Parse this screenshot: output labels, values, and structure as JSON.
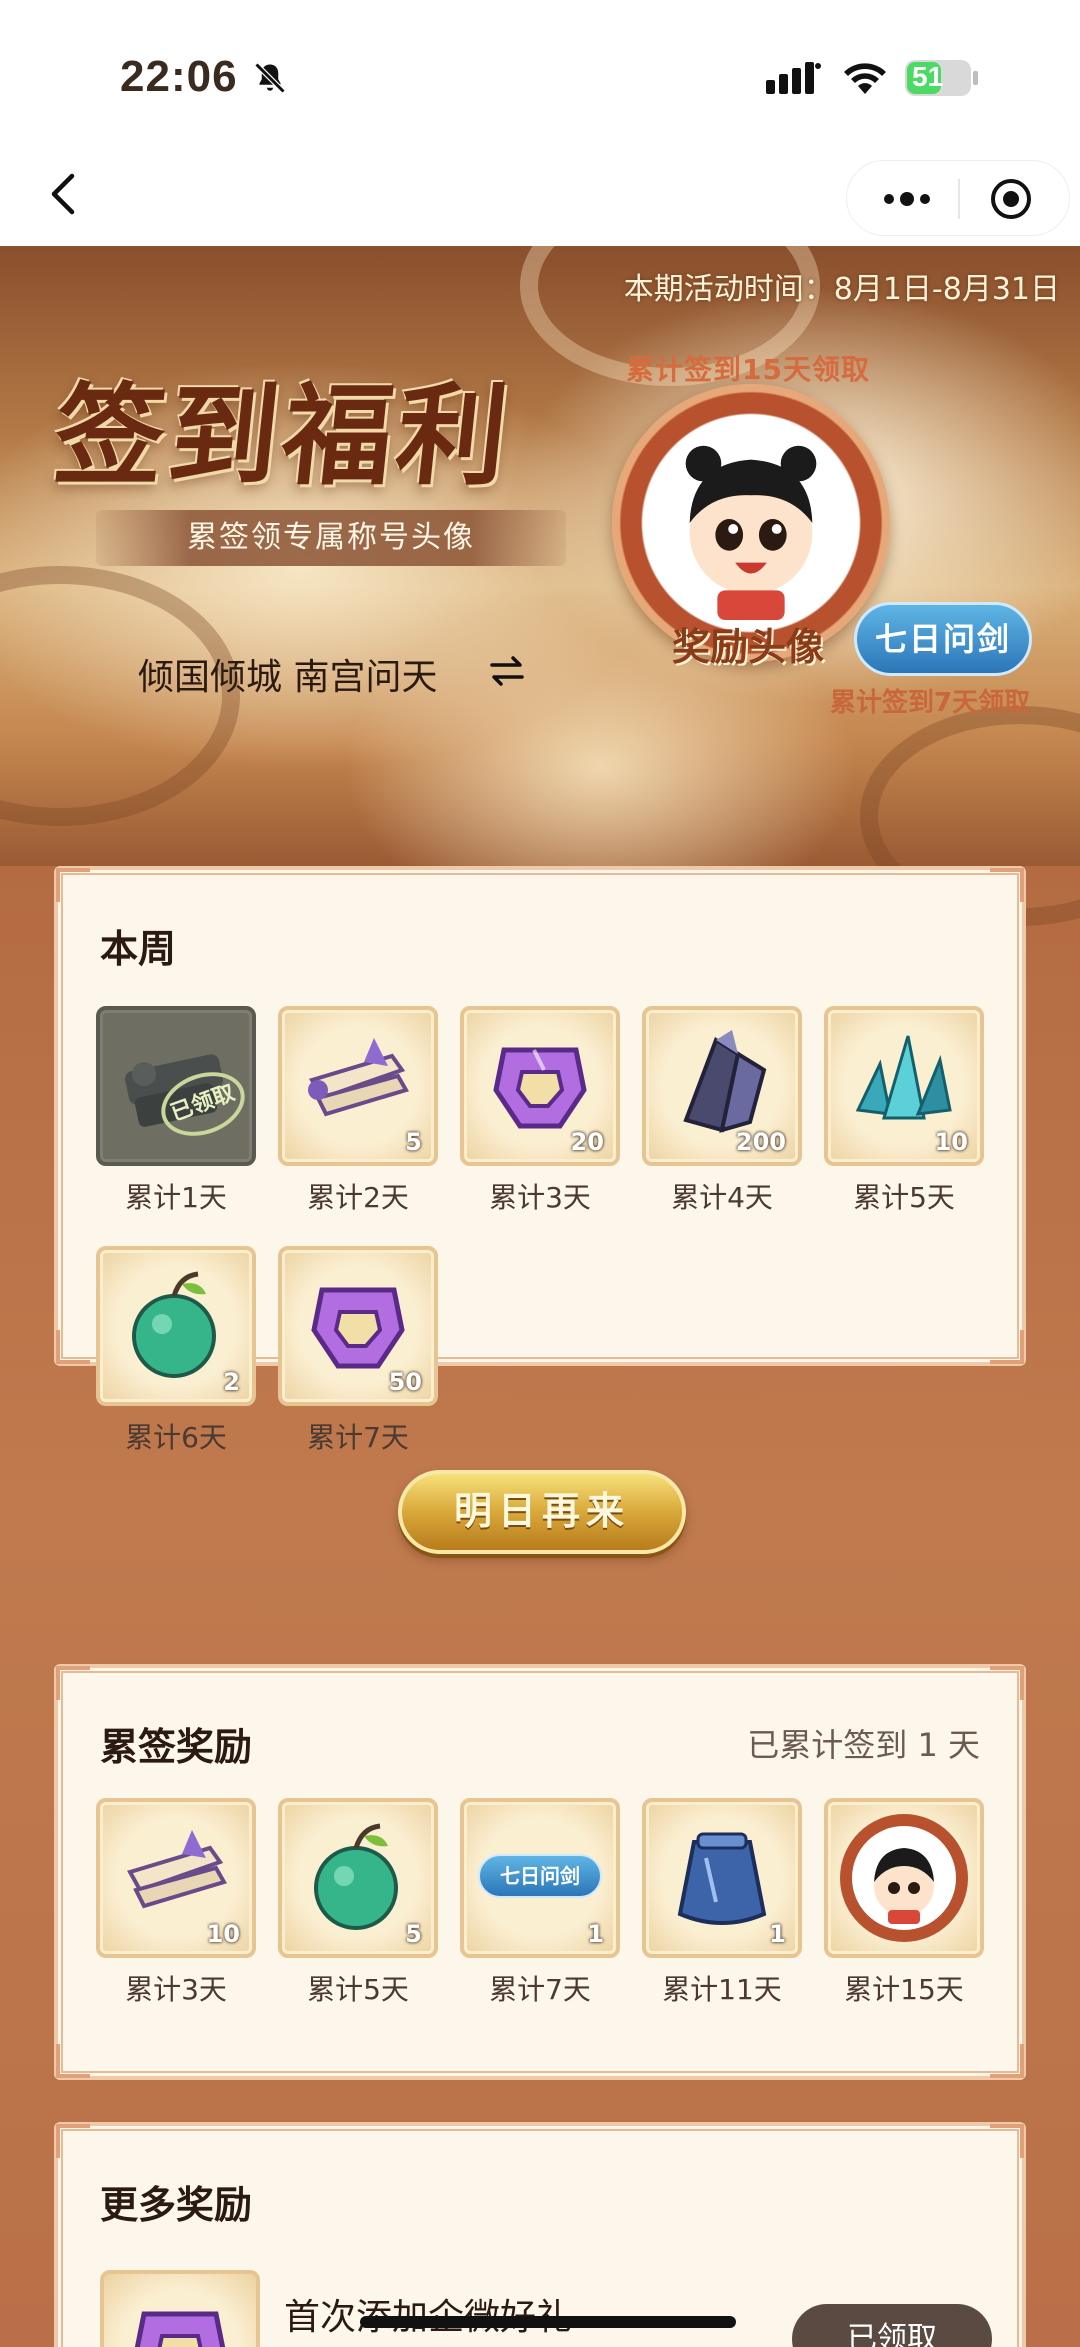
{
  "status_bar": {
    "time": "22:06",
    "battery": "51"
  },
  "hero": {
    "period": "本期活动时间：8月1日-8月31日",
    "title": "签到福利",
    "subtitle": "累签领专属称号头像",
    "server": "倾国倾城 南宫问天",
    "avatar_note_top": "累计签到15天领取",
    "avatar_label": "奖励头像",
    "title_badge": "七日问剑",
    "avatar_note_bottom": "累计签到7天领取"
  },
  "weekly": {
    "title": "本周",
    "claimed_stamp": "已领取",
    "items": [
      {
        "label": "累计1天",
        "qty": "",
        "icon": "scroll-claimed-icon"
      },
      {
        "label": "累计2天",
        "qty": "5",
        "icon": "scroll-icon"
      },
      {
        "label": "累计3天",
        "qty": "20",
        "icon": "purple-jade-icon"
      },
      {
        "label": "累计4天",
        "qty": "200",
        "icon": "dark-crystal-icon"
      },
      {
        "label": "累计5天",
        "qty": "10",
        "icon": "teal-crystal-icon"
      },
      {
        "label": "累计6天",
        "qty": "2",
        "icon": "green-fruit-icon"
      },
      {
        "label": "累计7天",
        "qty": "50",
        "icon": "purple-jade-icon"
      }
    ],
    "button": "明日再来"
  },
  "cumulative": {
    "title": "累签奖励",
    "progress": "已累计签到 1 天",
    "items": [
      {
        "label": "累计3天",
        "qty": "10",
        "icon": "scroll-icon"
      },
      {
        "label": "累计5天",
        "qty": "5",
        "icon": "green-fruit-icon"
      },
      {
        "label": "累计7天",
        "qty": "1",
        "icon": "title-badge-icon",
        "badge_text": "七日问剑"
      },
      {
        "label": "累计11天",
        "qty": "1",
        "icon": "blue-cloak-icon"
      },
      {
        "label": "累计15天",
        "qty": "",
        "icon": "avatar-frame-icon"
      }
    ]
  },
  "more": {
    "title": "更多奖励",
    "first_item": "首次添加企微好礼",
    "button": "已领取"
  },
  "colors": {
    "accent_gold": "#d9a83a",
    "card_bg": "#fdf6ea",
    "card_border": "#efc9a8",
    "badge_blue": "#2c76b8"
  }
}
